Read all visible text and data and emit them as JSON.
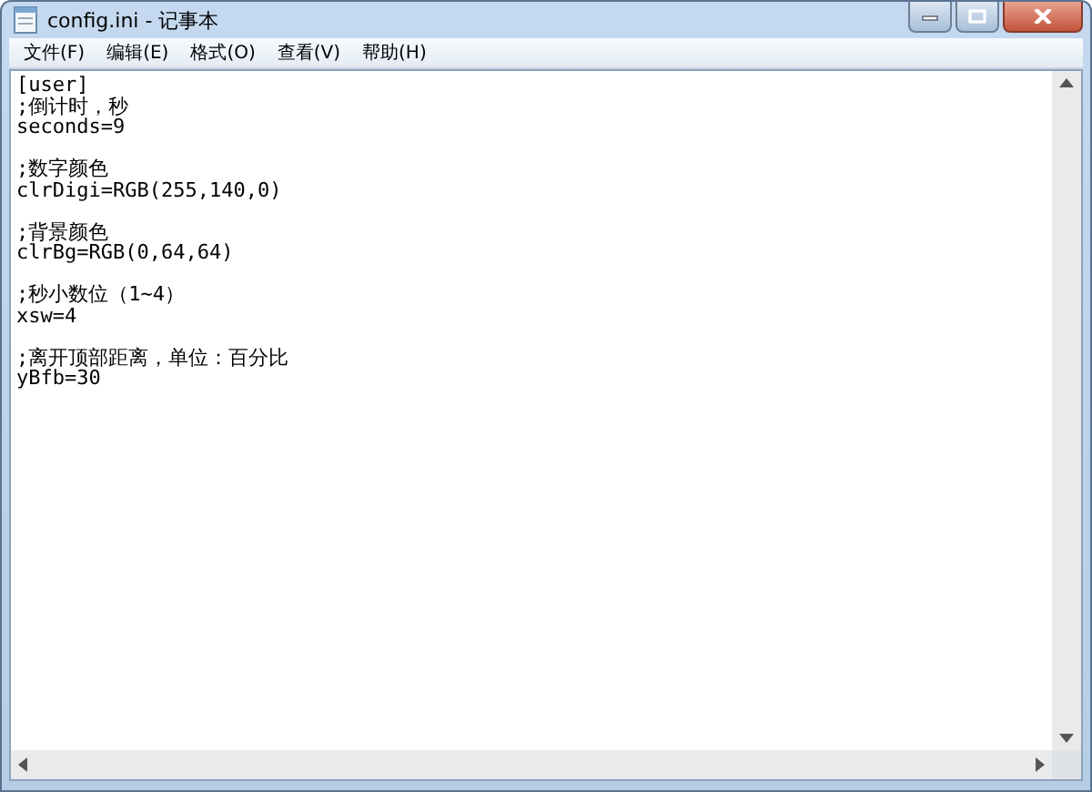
{
  "window": {
    "title": "config.ini - 记事本"
  },
  "menu": [
    "文件(F)",
    "编辑(E)",
    "格式(O)",
    "查看(V)",
    "帮助(H)"
  ],
  "editor": {
    "blocks": [
      [
        "[user]",
        ";倒计时，秒",
        "seconds=9"
      ],
      [
        ";数字颜色",
        "clrDigi=RGB(255,140,0)"
      ],
      [
        ";背景颜色",
        "clrBg=RGB(0,64,64)"
      ],
      [
        ";秒小数位（1~4）",
        "xsw=4"
      ],
      [
        ";离开顶部距离，单位：百分比",
        "yBfb=30"
      ]
    ]
  }
}
